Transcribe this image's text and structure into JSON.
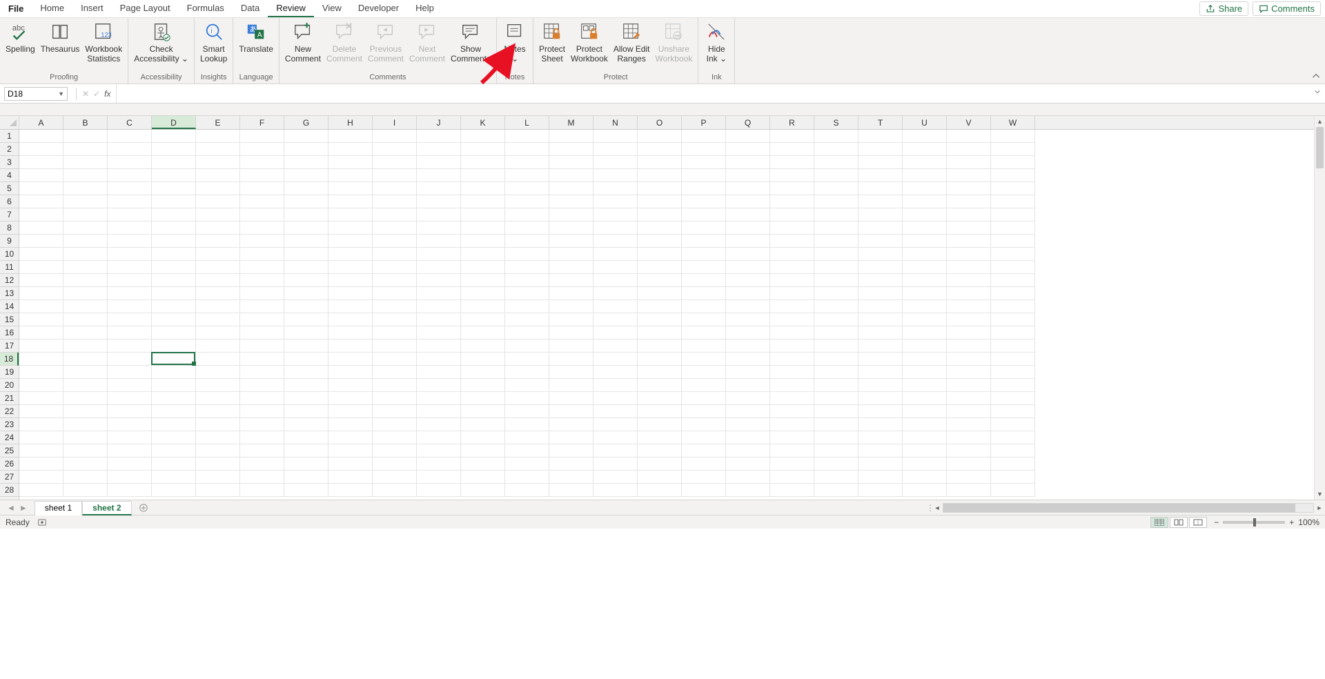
{
  "tabs": {
    "file": "File",
    "items": [
      "Home",
      "Insert",
      "Page Layout",
      "Formulas",
      "Data",
      "Review",
      "View",
      "Developer",
      "Help"
    ],
    "active": "Review",
    "share": "Share",
    "comments": "Comments"
  },
  "ribbon": {
    "groups": [
      {
        "name": "proofing",
        "label": "Proofing",
        "buttons": [
          {
            "id": "spelling",
            "label": "Spelling",
            "icon": "abc-check",
            "interact": true
          },
          {
            "id": "thesaurus",
            "label": "Thesaurus",
            "icon": "book",
            "interact": true
          },
          {
            "id": "workbook-statistics",
            "label": "Workbook\nStatistics",
            "icon": "stats",
            "interact": true
          }
        ]
      },
      {
        "name": "accessibility",
        "label": "Accessibility",
        "buttons": [
          {
            "id": "check-accessibility",
            "label": "Check\nAccessibility ⌄",
            "icon": "accessibility",
            "interact": true
          }
        ]
      },
      {
        "name": "insights",
        "label": "Insights",
        "buttons": [
          {
            "id": "smart-lookup",
            "label": "Smart\nLookup",
            "icon": "lookup",
            "interact": true
          }
        ]
      },
      {
        "name": "language",
        "label": "Language",
        "buttons": [
          {
            "id": "translate",
            "label": "Translate",
            "icon": "translate",
            "interact": true
          }
        ]
      },
      {
        "name": "comments",
        "label": "Comments",
        "buttons": [
          {
            "id": "new-comment",
            "label": "New\nComment",
            "icon": "new-comment",
            "interact": true
          },
          {
            "id": "delete-comment",
            "label": "Delete\nComment",
            "icon": "delete-comment",
            "interact": false
          },
          {
            "id": "previous-comment",
            "label": "Previous\nComment",
            "icon": "prev-comment",
            "interact": false
          },
          {
            "id": "next-comment",
            "label": "Next\nComment",
            "icon": "next-comment",
            "interact": false
          },
          {
            "id": "show-comments",
            "label": "Show\nComments",
            "icon": "show-comments",
            "interact": true
          }
        ]
      },
      {
        "name": "notes",
        "label": "Notes",
        "buttons": [
          {
            "id": "notes",
            "label": "Notes\n⌄",
            "icon": "notes",
            "interact": true
          }
        ]
      },
      {
        "name": "protect",
        "label": "Protect",
        "buttons": [
          {
            "id": "protect-sheet",
            "label": "Protect\nSheet",
            "icon": "protect-sheet",
            "interact": true
          },
          {
            "id": "protect-workbook",
            "label": "Protect\nWorkbook",
            "icon": "protect-wb",
            "interact": true
          },
          {
            "id": "allow-edit-ranges",
            "label": "Allow Edit\nRanges",
            "icon": "allow-ranges",
            "interact": true
          },
          {
            "id": "unshare-workbook",
            "label": "Unshare\nWorkbook",
            "icon": "unshare",
            "interact": false
          }
        ]
      },
      {
        "name": "ink",
        "label": "Ink",
        "buttons": [
          {
            "id": "hide-ink",
            "label": "Hide\nInk ⌄",
            "icon": "ink",
            "interact": true
          }
        ]
      }
    ]
  },
  "formula_bar": {
    "name_box": "D18",
    "fx_label": "fx",
    "formula": ""
  },
  "grid": {
    "columns": [
      "A",
      "B",
      "C",
      "D",
      "E",
      "F",
      "G",
      "H",
      "I",
      "J",
      "K",
      "L",
      "M",
      "N",
      "O",
      "P",
      "Q",
      "R",
      "S",
      "T",
      "U",
      "V",
      "W"
    ],
    "rows": [
      1,
      2,
      3,
      4,
      5,
      6,
      7,
      8,
      9,
      10,
      11,
      12,
      13,
      14,
      15,
      16,
      17,
      18,
      19,
      20,
      21,
      22,
      23,
      24,
      25,
      26,
      27,
      28
    ],
    "selected_cell": "D18",
    "selected_col_index": 3,
    "selected_row_index": 17
  },
  "sheets": {
    "tabs": [
      "sheet 1",
      "sheet 2"
    ],
    "active": "sheet 2"
  },
  "status": {
    "ready": "Ready",
    "zoom": "100%"
  },
  "annotation": {
    "type": "red-arrow",
    "target": "protect-sheet"
  }
}
